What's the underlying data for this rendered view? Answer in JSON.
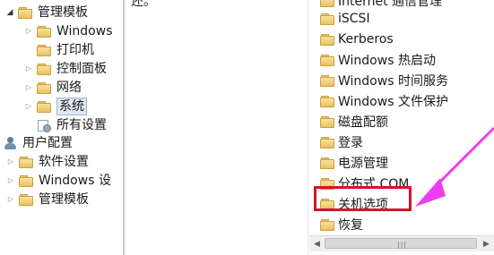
{
  "left_tree": {
    "items": [
      {
        "label": "管理模板",
        "expander": "open"
      },
      {
        "label": "Windows",
        "expander": "closed"
      },
      {
        "label": "打印机",
        "expander": "none"
      },
      {
        "label": "控制面板",
        "expander": "closed"
      },
      {
        "label": "网络",
        "expander": "closed"
      },
      {
        "label": "系统",
        "expander": "closed",
        "selected": true
      },
      {
        "label": "所有设置",
        "expander": "none",
        "icon": "settings-icon"
      },
      {
        "label": "用户配置",
        "expander": "none",
        "icon": "user-icon"
      },
      {
        "label": "软件设置",
        "expander": "closed"
      },
      {
        "label": "Windows 设",
        "expander": "closed"
      },
      {
        "label": "管理模板",
        "expander": "closed"
      }
    ]
  },
  "middle_pane": {
    "truncated_text": "还。"
  },
  "right_list": {
    "items": [
      "Internet 通信管理",
      "iSCSI",
      "Kerberos",
      "Windows 热启动",
      "Windows 时间服务",
      "Windows 文件保护",
      "磁盘配额",
      "登录",
      "电源管理",
      "分布式 COM",
      "关机选项",
      "恢复"
    ],
    "highlighted_item": "关机选项"
  },
  "annotation": {
    "highlight_color": "#d6122e",
    "arrow_color": "#f03cf0"
  },
  "scrollbar": {
    "left_arrow": "◀",
    "right_arrow": "▶",
    "grip": "|||"
  },
  "icons": {
    "expander_open": "◢",
    "expander_closed": "▷"
  }
}
